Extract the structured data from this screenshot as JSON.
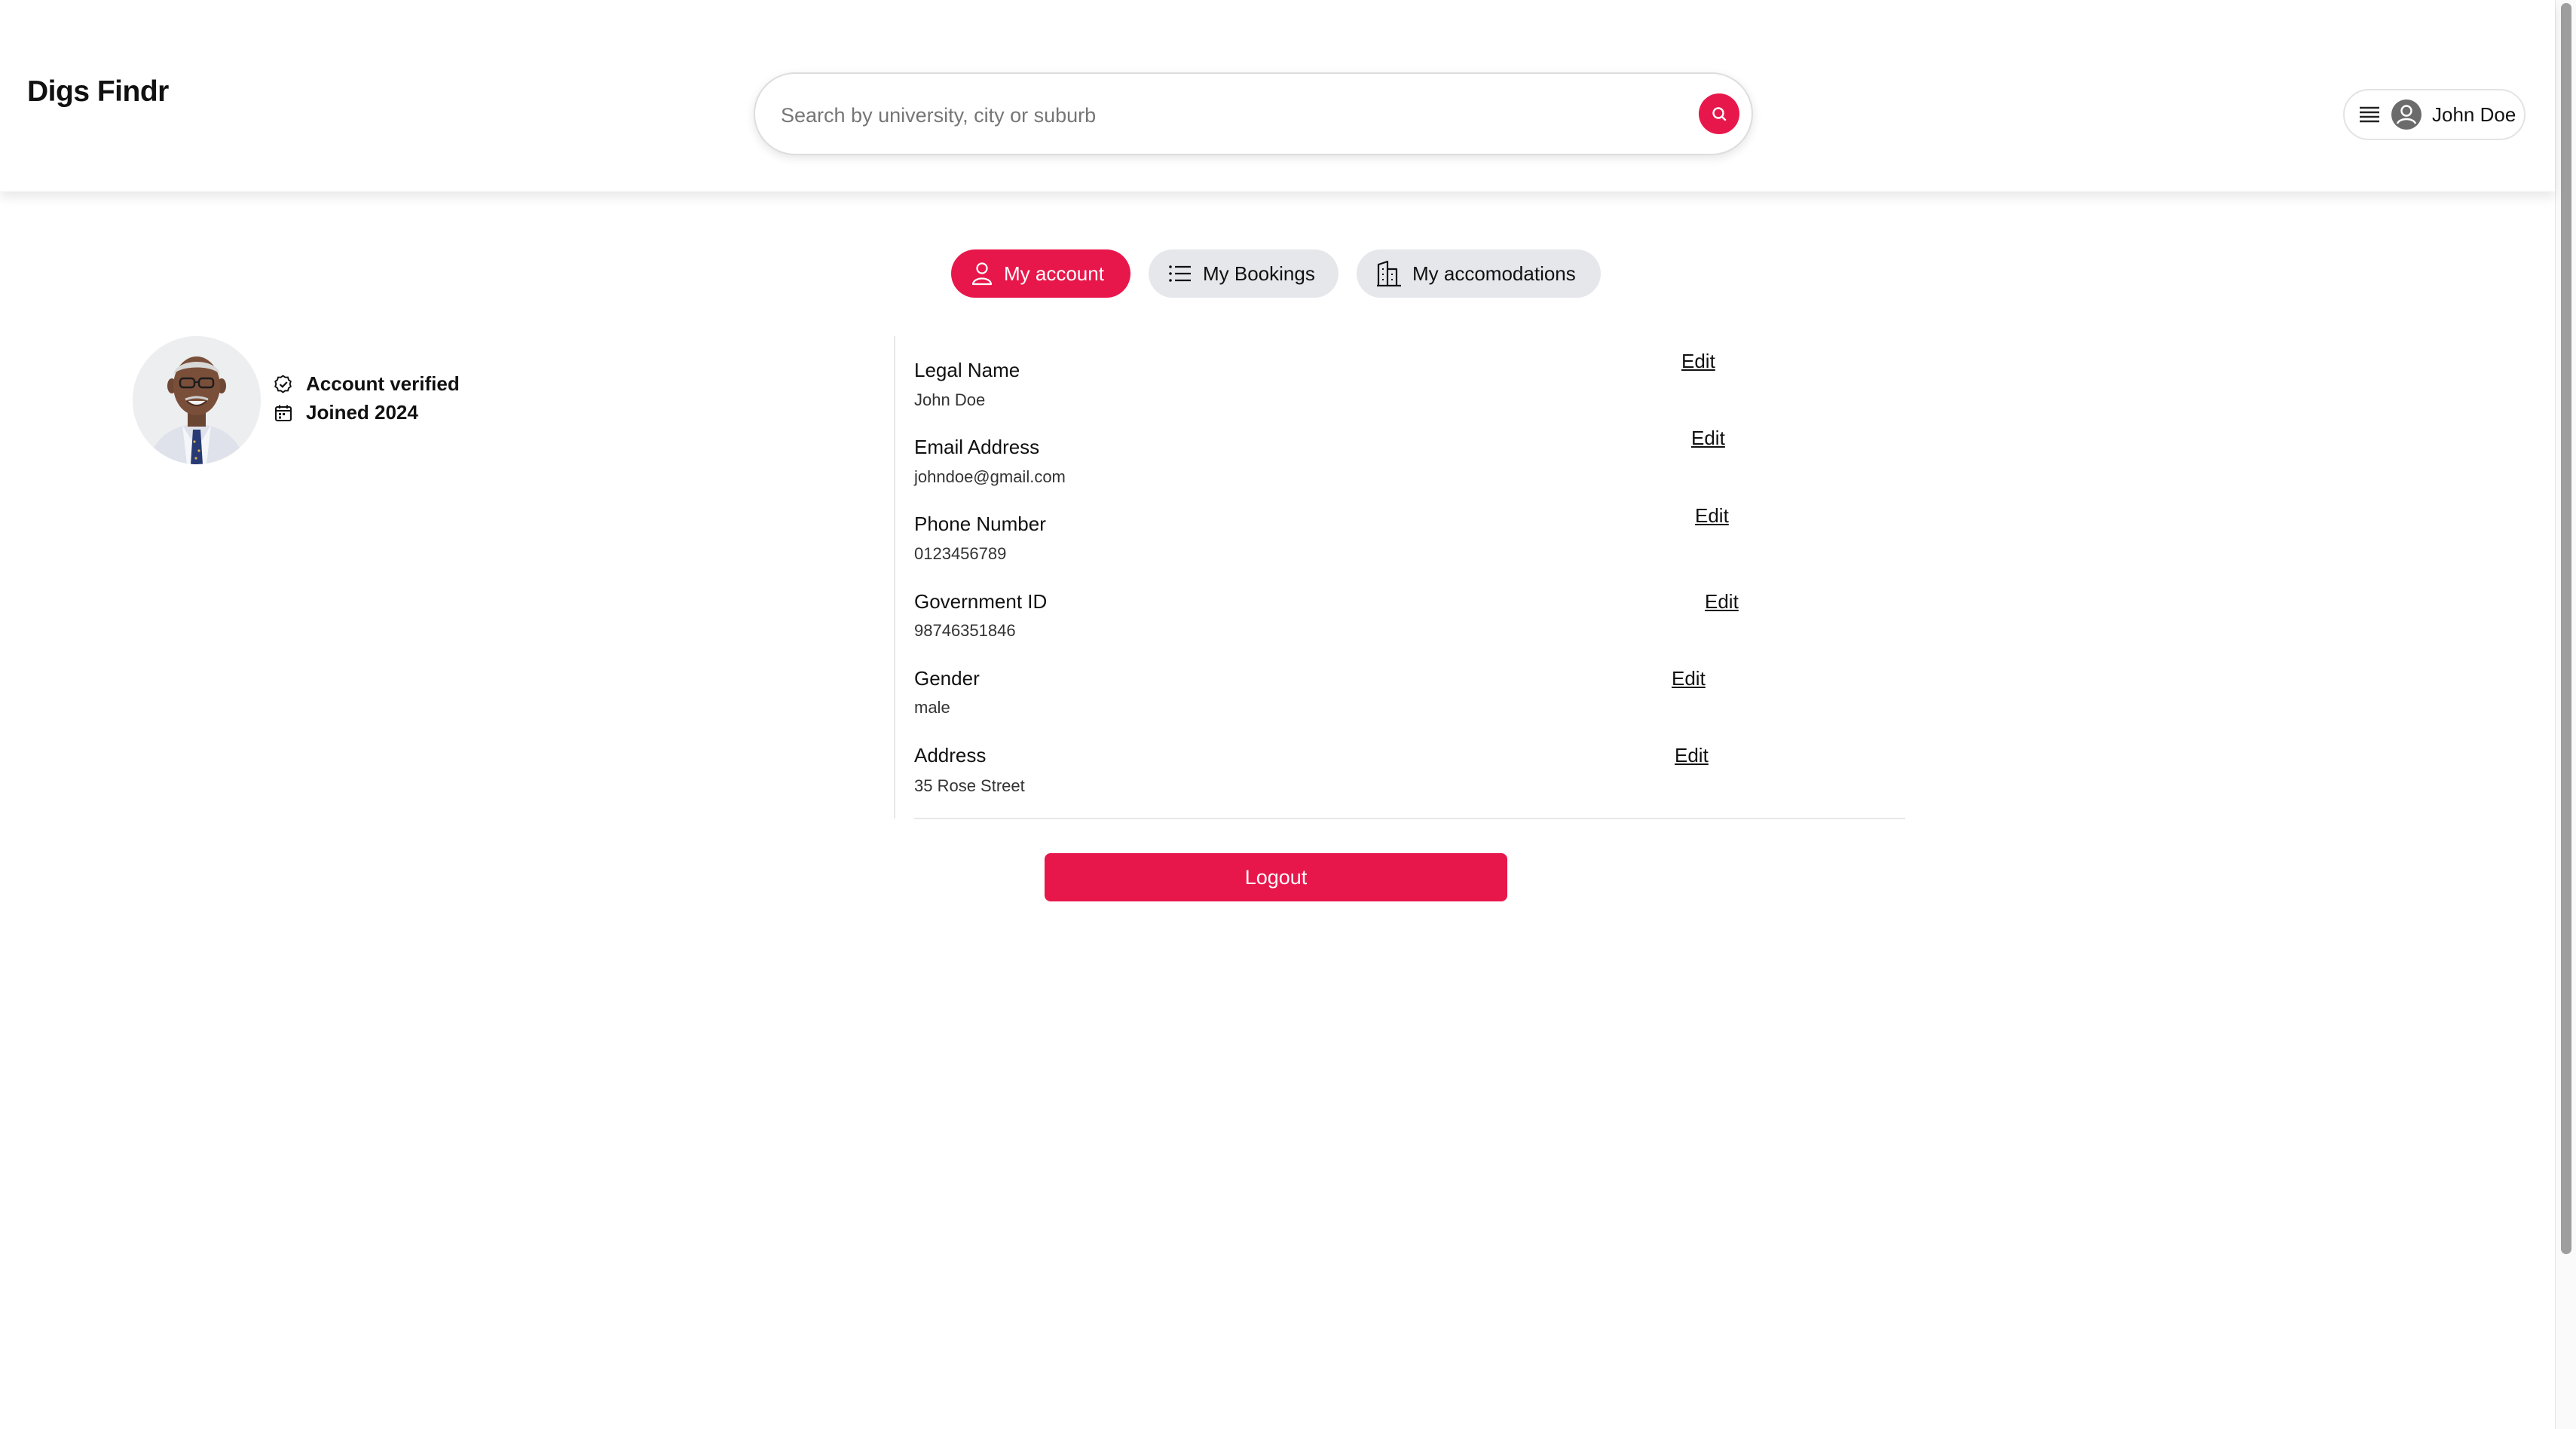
{
  "header": {
    "logo": "Digs Findr",
    "search": {
      "placeholder": "Search by university, city or suburb",
      "value": ""
    },
    "user_menu": {
      "name": "John Doe"
    }
  },
  "tabs": [
    {
      "label": "My account",
      "active": true,
      "icon": "user-icon"
    },
    {
      "label": "My Bookings",
      "active": false,
      "icon": "list-icon"
    },
    {
      "label": "My accomodations",
      "active": false,
      "icon": "building-icon"
    }
  ],
  "profile": {
    "verified": "Account verified",
    "joined": "Joined 2024"
  },
  "fields": [
    {
      "label": "Legal Name",
      "value": "John Doe",
      "edit": "Edit"
    },
    {
      "label": "Email Address",
      "value": "johndoe@gmail.com",
      "edit": "Edit"
    },
    {
      "label": "Phone Number",
      "value": "0123456789",
      "edit": "Edit"
    },
    {
      "label": "Government ID",
      "value": "98746351846",
      "edit": "Edit"
    },
    {
      "label": "Gender",
      "value": "male",
      "edit": "Edit"
    },
    {
      "label": "Address",
      "value": "35 Rose Street",
      "edit": "Edit"
    }
  ],
  "logout_label": "Logout",
  "colors": {
    "accent": "#e8174b",
    "tab_inactive": "#e5e7eb"
  }
}
